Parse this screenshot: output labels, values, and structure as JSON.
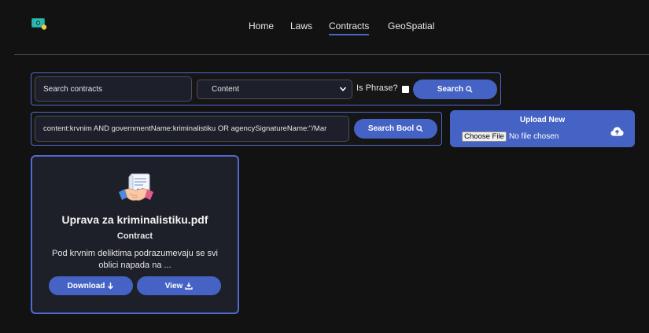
{
  "nav": {
    "items": [
      "Home",
      "Laws",
      "Contracts",
      "GeoSpatial"
    ],
    "active": "Contracts"
  },
  "search": {
    "placeholder": "Search contracts",
    "select_value": "Content",
    "phrase_label": "Is Phrase?",
    "search_label": "Search",
    "bool_query": "content:krvnim AND governmentName:kriminalistiku OR agencySignatureName:\"/Mar",
    "bool_label": "Search Bool"
  },
  "upload": {
    "title": "Upload New",
    "choose_label": "Choose File",
    "status": "No file chosen"
  },
  "card": {
    "title": "Uprava za kriminalistiku.pdf",
    "type": "Contract",
    "description": "Pod krvnim deliktima podrazumevaju se svi oblici napada na ...",
    "download_label": "Download",
    "view_label": "View"
  },
  "colors": {
    "accent": "#4563c4",
    "border": "#4f6ad1",
    "background": "#121212",
    "card": "#1e2029"
  }
}
